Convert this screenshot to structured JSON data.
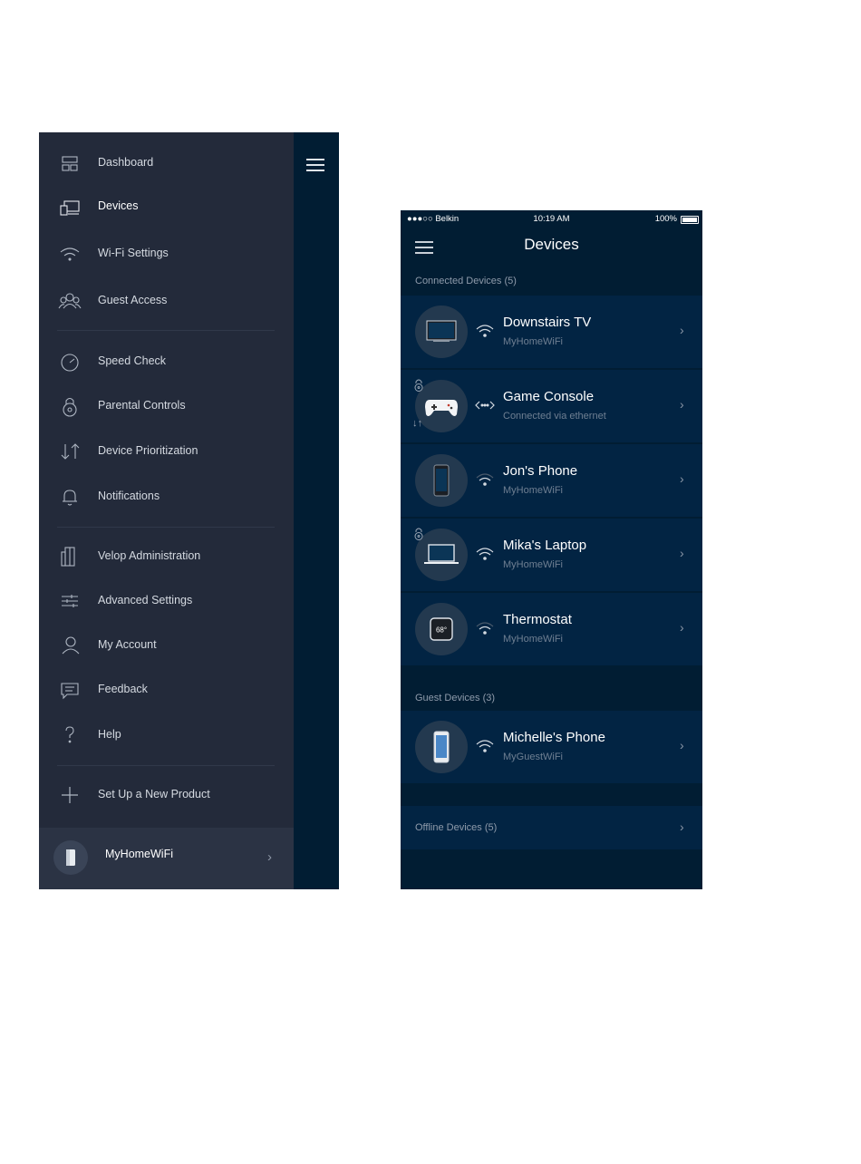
{
  "side_menu": {
    "items": [
      {
        "label": "Dashboard",
        "icon": "dashboard-icon"
      },
      {
        "label": "Devices",
        "icon": "devices-icon"
      },
      {
        "label": "Wi-Fi Settings",
        "icon": "wifi-icon"
      },
      {
        "label": "Guest Access",
        "icon": "guest-access-icon"
      },
      {
        "label": "Speed Check",
        "icon": "speedometer-icon"
      },
      {
        "label": "Parental Controls",
        "icon": "parental-lock-icon"
      },
      {
        "label": "Device Prioritization",
        "icon": "prioritization-arrows-icon"
      },
      {
        "label": "Notifications",
        "icon": "bell-icon"
      },
      {
        "label": "Velop Administration",
        "icon": "velop-node-icon"
      },
      {
        "label": "Advanced Settings",
        "icon": "sliders-icon"
      },
      {
        "label": "My Account",
        "icon": "user-icon"
      },
      {
        "label": "Feedback",
        "icon": "feedback-icon"
      },
      {
        "label": "Help",
        "icon": "help-icon"
      },
      {
        "label": "Set Up a New Product",
        "icon": "plus-icon"
      }
    ],
    "active_item": "Devices",
    "network": {
      "name": "MyHomeWiFi"
    }
  },
  "devices_screen": {
    "status_bar": {
      "carrier": "●●●○○ Belkin",
      "time": "10:19 AM",
      "battery": "100%"
    },
    "title": "Devices",
    "connected_label": "Connected Devices (5)",
    "connected": [
      {
        "name": "Downstairs TV",
        "sub": "MyHomeWiFi",
        "icon": "tv-icon",
        "connection": "wifi"
      },
      {
        "name": "Game Console",
        "sub": "Connected via ethernet",
        "icon": "gamepad-icon",
        "connection": "ethernet"
      },
      {
        "name": "Jon's Phone",
        "sub": "MyHomeWiFi",
        "icon": "smartphone-icon",
        "connection": "wifi"
      },
      {
        "name": "Mika's Laptop",
        "sub": "MyHomeWiFi",
        "icon": "laptop-icon",
        "connection": "wifi"
      },
      {
        "name": "Thermostat",
        "sub": "MyHomeWiFi",
        "icon": "thermostat-icon",
        "connection": "wifi",
        "display": "68°"
      }
    ],
    "guest_label": "Guest Devices (3)",
    "guest": [
      {
        "name": "Michelle's Phone",
        "sub": "MyGuestWiFi",
        "icon": "smartphone-icon",
        "connection": "wifi"
      }
    ],
    "offline_label": "Offline Devices (5)"
  },
  "colors": {
    "menu_bg": "#232a3a",
    "app_bg": "#011d33",
    "row_bg": "#022443"
  }
}
